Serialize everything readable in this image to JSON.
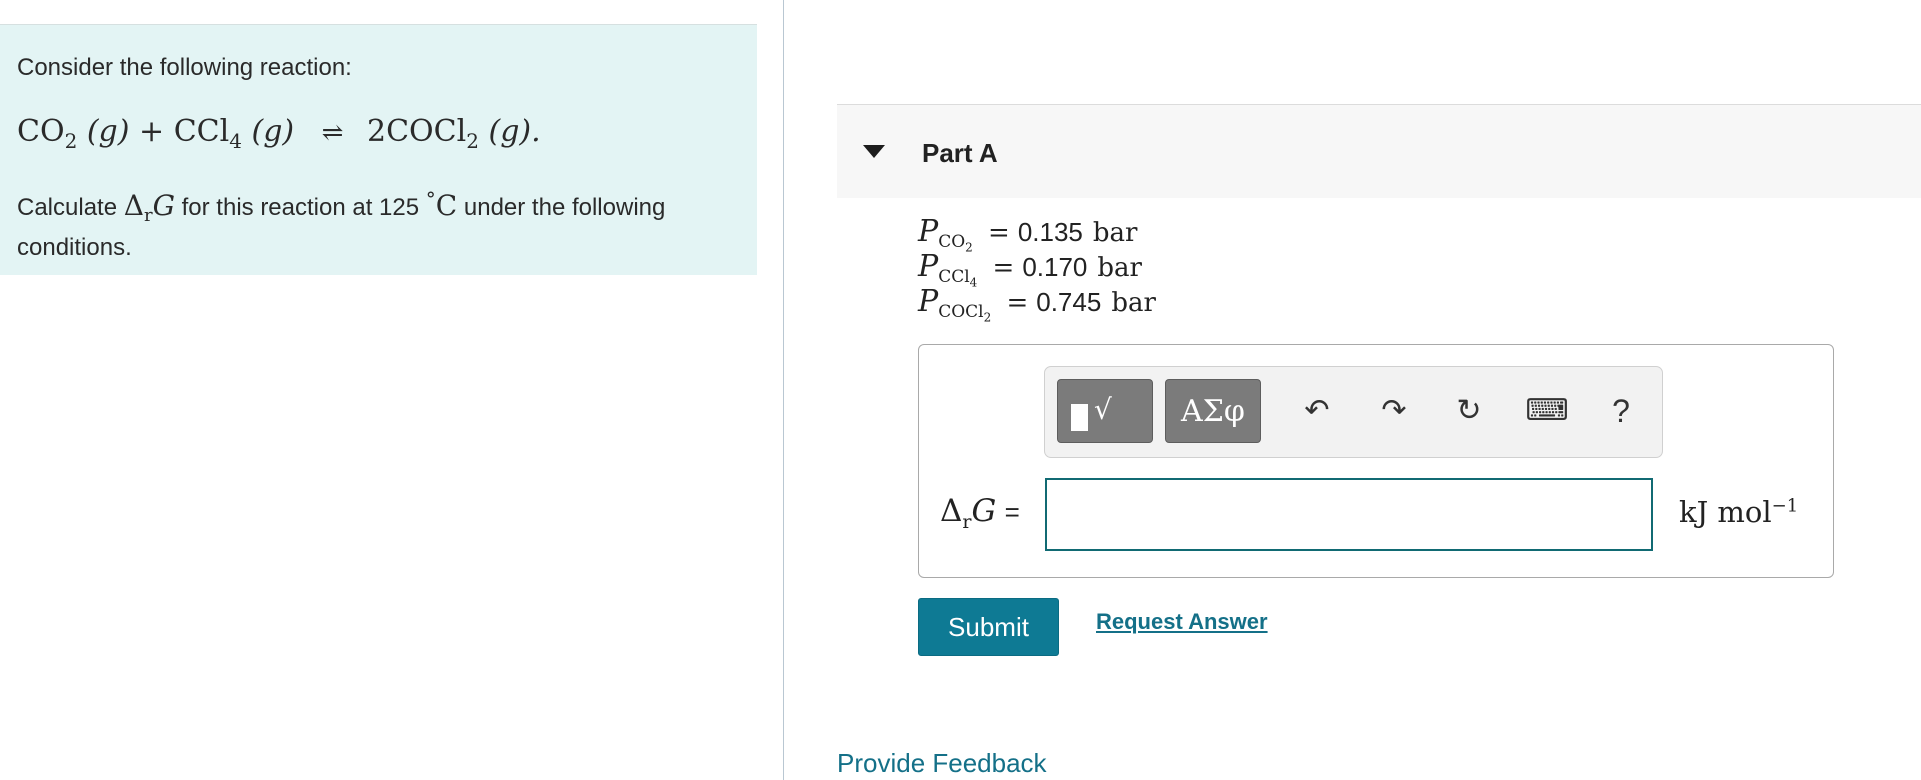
{
  "problem": {
    "intro": "Consider the following reaction:",
    "reaction": {
      "reactant1": "CO",
      "reactant1_sub": "2",
      "phase1": "(g)",
      "plus": "+",
      "reactant2": "CCl",
      "reactant2_sub": "4",
      "phase2": "(g)",
      "arrow": "⇌",
      "product": "2COCl",
      "product_sub": "2",
      "phase3": "(g).",
      "arrow_icon": "equilibrium-arrow"
    },
    "question_before": "Calculate",
    "question_delta": "Δ",
    "question_sub": "r",
    "question_G": "G",
    "question_mid": "for this reaction at 125",
    "question_deg": "°",
    "question_C": "C",
    "question_after": "under the following conditions."
  },
  "part": {
    "title": "Part A",
    "collapse_icon": "caret-down-icon"
  },
  "conditions": [
    {
      "P": "P",
      "species": "CO",
      "sub": "2",
      "eq": "=",
      "value": "0.135",
      "unit": "bar"
    },
    {
      "P": "P",
      "species": "CCl",
      "sub": "4",
      "eq": "=",
      "value": "0.170",
      "unit": "bar"
    },
    {
      "P": "P",
      "species": "COCl",
      "sub": "2",
      "eq": "=",
      "value": "0.745",
      "unit": "bar"
    }
  ],
  "toolbar": {
    "templates_symbol": "√",
    "greek_label": "ΑΣφ",
    "undo": "↶",
    "redo": "↷",
    "reset": "↻",
    "keyboard": "⌨",
    "help": "?"
  },
  "answer": {
    "label_delta": "Δ",
    "label_sub": "r",
    "label_G": "G",
    "label_eq": "=",
    "value": "",
    "unit_main": "kJ mol",
    "unit_sup": "−1"
  },
  "actions": {
    "submit": "Submit",
    "request_answer": "Request Answer"
  },
  "footer": {
    "feedback": "Provide Feedback"
  },
  "colors": {
    "left_panel_bg": "#e3f4f4",
    "accent": "#0e7a94",
    "link": "#147088"
  }
}
